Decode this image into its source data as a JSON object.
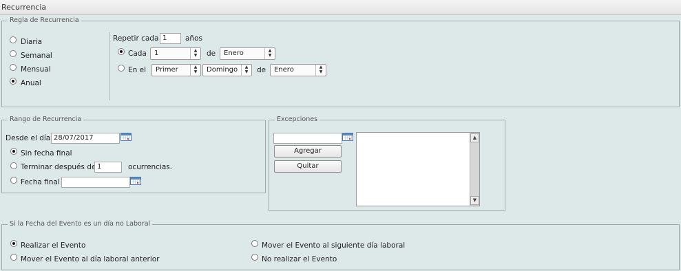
{
  "window": {
    "title": "Recurrencia"
  },
  "rule": {
    "legend": "Regla de Recurrencia",
    "options": [
      "Diaria",
      "Semanal",
      "Mensual",
      "Anual"
    ],
    "selected": "Anual",
    "repeat_label": "Repetir cada",
    "repeat_value": "1",
    "repeat_unit": "años",
    "cada_label": "Cada",
    "cada_day": "1",
    "de_label_1": "de",
    "cada_month": "Enero",
    "enel_label": "En el",
    "enel_ordinal": "Primer",
    "enel_weekday": "Domingo",
    "de_label_2": "de",
    "enel_month": "Enero"
  },
  "range": {
    "legend": "Rango de Recurrencia",
    "start_label": "Desde el día",
    "start_value": "28/07/2017",
    "no_end_label": "Sin fecha final",
    "end_after_label": "Terminar después de",
    "end_after_value": "1",
    "occurrences_label": "ocurrencias.",
    "end_date_label": "Fecha final",
    "end_date_value": ""
  },
  "exceptions": {
    "legend": "Excepciones",
    "date_value": "",
    "add_label": "Agregar",
    "remove_label": "Quitar"
  },
  "nonworking": {
    "legend": "Si la Fecha del Evento es un día no Laboral",
    "opt_do": "Realizar el Evento",
    "opt_next": "Mover el Evento al siguiente día laboral",
    "opt_prev": "Mover el Evento al día laboral anterior",
    "opt_skip": "No realizar el Evento"
  }
}
